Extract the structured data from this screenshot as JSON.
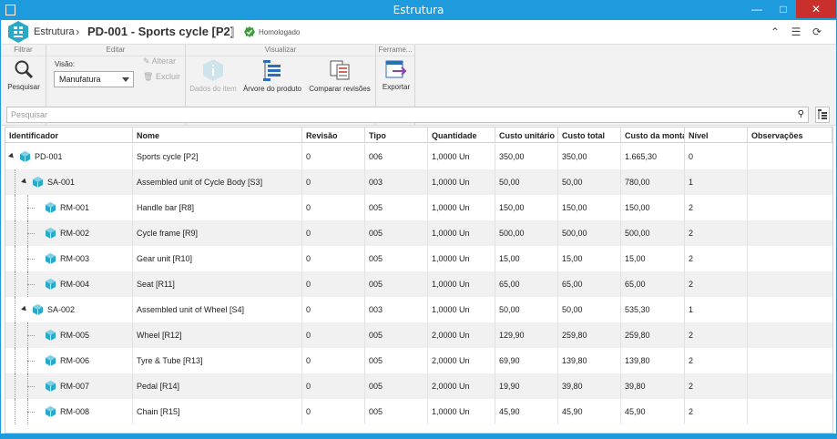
{
  "window": {
    "title": "Estrutura"
  },
  "header": {
    "crumb": "Estrutura",
    "title": "PD-001 - Sports cycle [P2]",
    "status": "Homologado"
  },
  "ribbon": {
    "groups": {
      "filtrar": "Filtrar",
      "editar": "Editar",
      "visualizar": "Visualizar",
      "ferramentas": "Ferrame..."
    },
    "pesquisar": "Pesquisar",
    "visao_label": "Visão:",
    "visao_value": "Manufatura",
    "alterar": "Alterar",
    "excluir": "Excluir",
    "dados_item": "Dados do item",
    "arvore": "Árvore do produto",
    "comparar": "Comparar revisões",
    "exportar": "Exportar"
  },
  "search": {
    "placeholder": "Pesquisar"
  },
  "grid": {
    "columns": [
      "Identificador",
      "Nome",
      "Revisão",
      "Tipo",
      "Quantidade",
      "Custo unitário",
      "Custo total",
      "Custo da montag",
      "Nível",
      "Observações"
    ],
    "rows": [
      {
        "id": "PD-001",
        "level": 0,
        "expander": true,
        "nome": "Sports cycle [P2]",
        "rev": "0",
        "tipo": "006",
        "qtd": "1,0000 Un",
        "cu": "350,00",
        "ct": "350,00",
        "cm": "1.665,30",
        "nivel": "0"
      },
      {
        "id": "SA-001",
        "level": 1,
        "expander": true,
        "nome": "Assembled unit of Cycle Body [S3]",
        "rev": "0",
        "tipo": "003",
        "qtd": "1,0000 Un",
        "cu": "50,00",
        "ct": "50,00",
        "cm": "780,00",
        "nivel": "1"
      },
      {
        "id": "RM-001",
        "level": 2,
        "expander": false,
        "nome": "Handle bar [R8]",
        "rev": "0",
        "tipo": "005",
        "qtd": "1,0000 Un",
        "cu": "150,00",
        "ct": "150,00",
        "cm": "150,00",
        "nivel": "2"
      },
      {
        "id": "RM-002",
        "level": 2,
        "expander": false,
        "nome": "Cycle frame [R9]",
        "rev": "0",
        "tipo": "005",
        "qtd": "1,0000 Un",
        "cu": "500,00",
        "ct": "500,00",
        "cm": "500,00",
        "nivel": "2"
      },
      {
        "id": "RM-003",
        "level": 2,
        "expander": false,
        "nome": "Gear unit [R10]",
        "rev": "0",
        "tipo": "005",
        "qtd": "1,0000 Un",
        "cu": "15,00",
        "ct": "15,00",
        "cm": "15,00",
        "nivel": "2"
      },
      {
        "id": "RM-004",
        "level": 2,
        "expander": false,
        "nome": "Seat [R11]",
        "rev": "0",
        "tipo": "005",
        "qtd": "1,0000 Un",
        "cu": "65,00",
        "ct": "65,00",
        "cm": "65,00",
        "nivel": "2"
      },
      {
        "id": "SA-002",
        "level": 1,
        "expander": true,
        "nome": "Assembled unit of Wheel [S4]",
        "rev": "0",
        "tipo": "003",
        "qtd": "1,0000 Un",
        "cu": "50,00",
        "ct": "50,00",
        "cm": "535,30",
        "nivel": "1"
      },
      {
        "id": "RM-005",
        "level": 2,
        "expander": false,
        "nome": "Wheel [R12]",
        "rev": "0",
        "tipo": "005",
        "qtd": "2,0000 Un",
        "cu": "129,90",
        "ct": "259,80",
        "cm": "259,80",
        "nivel": "2"
      },
      {
        "id": "RM-006",
        "level": 2,
        "expander": false,
        "nome": "Tyre & Tube [R13]",
        "rev": "0",
        "tipo": "005",
        "qtd": "2,0000 Un",
        "cu": "69,90",
        "ct": "139,80",
        "cm": "139,80",
        "nivel": "2"
      },
      {
        "id": "RM-007",
        "level": 2,
        "expander": false,
        "nome": "Pedal [R14]",
        "rev": "0",
        "tipo": "005",
        "qtd": "2,0000 Un",
        "cu": "19,90",
        "ct": "39,80",
        "cm": "39,80",
        "nivel": "2"
      },
      {
        "id": "RM-008",
        "level": 2,
        "expander": false,
        "nome": "Chain [R15]",
        "rev": "0",
        "tipo": "005",
        "qtd": "1,0000 Un",
        "cu": "45,90",
        "ct": "45,90",
        "cm": "45,90",
        "nivel": "2"
      }
    ]
  },
  "colors": {
    "titlebar": "#1e9bdc",
    "accent": "#2aa8c7",
    "ok": "#3a9c3a"
  },
  "icons": [
    "app-icon",
    "logo-icon",
    "chevron-right-icon",
    "check-badge-icon",
    "collapse-up-icon",
    "list-icon",
    "refresh-icon",
    "search-icon",
    "pencil-icon",
    "trash-icon",
    "info-icon",
    "tree-icon",
    "compare-icon",
    "export-icon",
    "column-config-icon",
    "cube-icon"
  ]
}
